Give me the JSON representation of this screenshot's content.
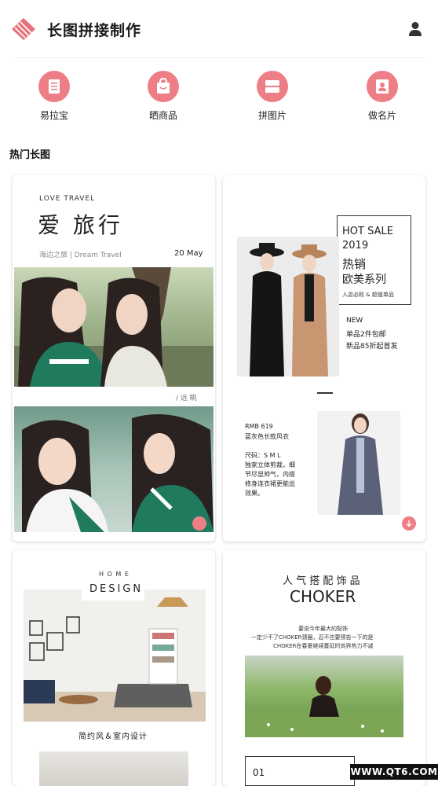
{
  "header": {
    "title": "长图拼接制作"
  },
  "nav": [
    {
      "label": "易拉宝",
      "icon": "rollup-banner-icon"
    },
    {
      "label": "晒商品",
      "icon": "shopping-bag-icon"
    },
    {
      "label": "拼图片",
      "icon": "collage-icon"
    },
    {
      "label": "做名片",
      "icon": "business-card-icon"
    }
  ],
  "section": {
    "title": "热门长图"
  },
  "cards": {
    "travel": {
      "eyebrow": "LOVE   TRAVEL",
      "title": "爱 旅行",
      "subtitle": "海边之旅 | Dream Travel",
      "date": "20 May",
      "caption": "/ 远 眺"
    },
    "fashion": {
      "box_line1": "HOT SALE",
      "box_line2": "2019",
      "box_line3": "热销",
      "box_line4": "欧美系列",
      "box_small": "入店必败 & 超值单品",
      "new": "NEW",
      "promo1": "单品2件包邮",
      "promo2": "新品85折起首发",
      "price": "RMB 619",
      "product": "蓝灰色长款风衣",
      "desc1": "尺码：S M L",
      "desc2": "独家立体剪裁，细",
      "desc3": "节尽显帅气，内搭",
      "desc4": "修身连衣裙更能出",
      "desc5": "效果。"
    },
    "home": {
      "small": "H O M E",
      "big": "DESIGN",
      "caption": "简约风＆室内设计"
    },
    "choker": {
      "title": "人 气 搭 配 饰 品",
      "brand": "CHOKER",
      "line1": "要说今年最大的配饰",
      "line2": "一定少不了CHOKER颈圈，忍不住要预告一下的是",
      "line3": "CHOKER在春夏继续蔓延时尚界热力不减",
      "number": "01"
    }
  },
  "watermark": "WWW.QT6.COM",
  "colors": {
    "accent": "#ee7e86",
    "text": "#222222"
  }
}
